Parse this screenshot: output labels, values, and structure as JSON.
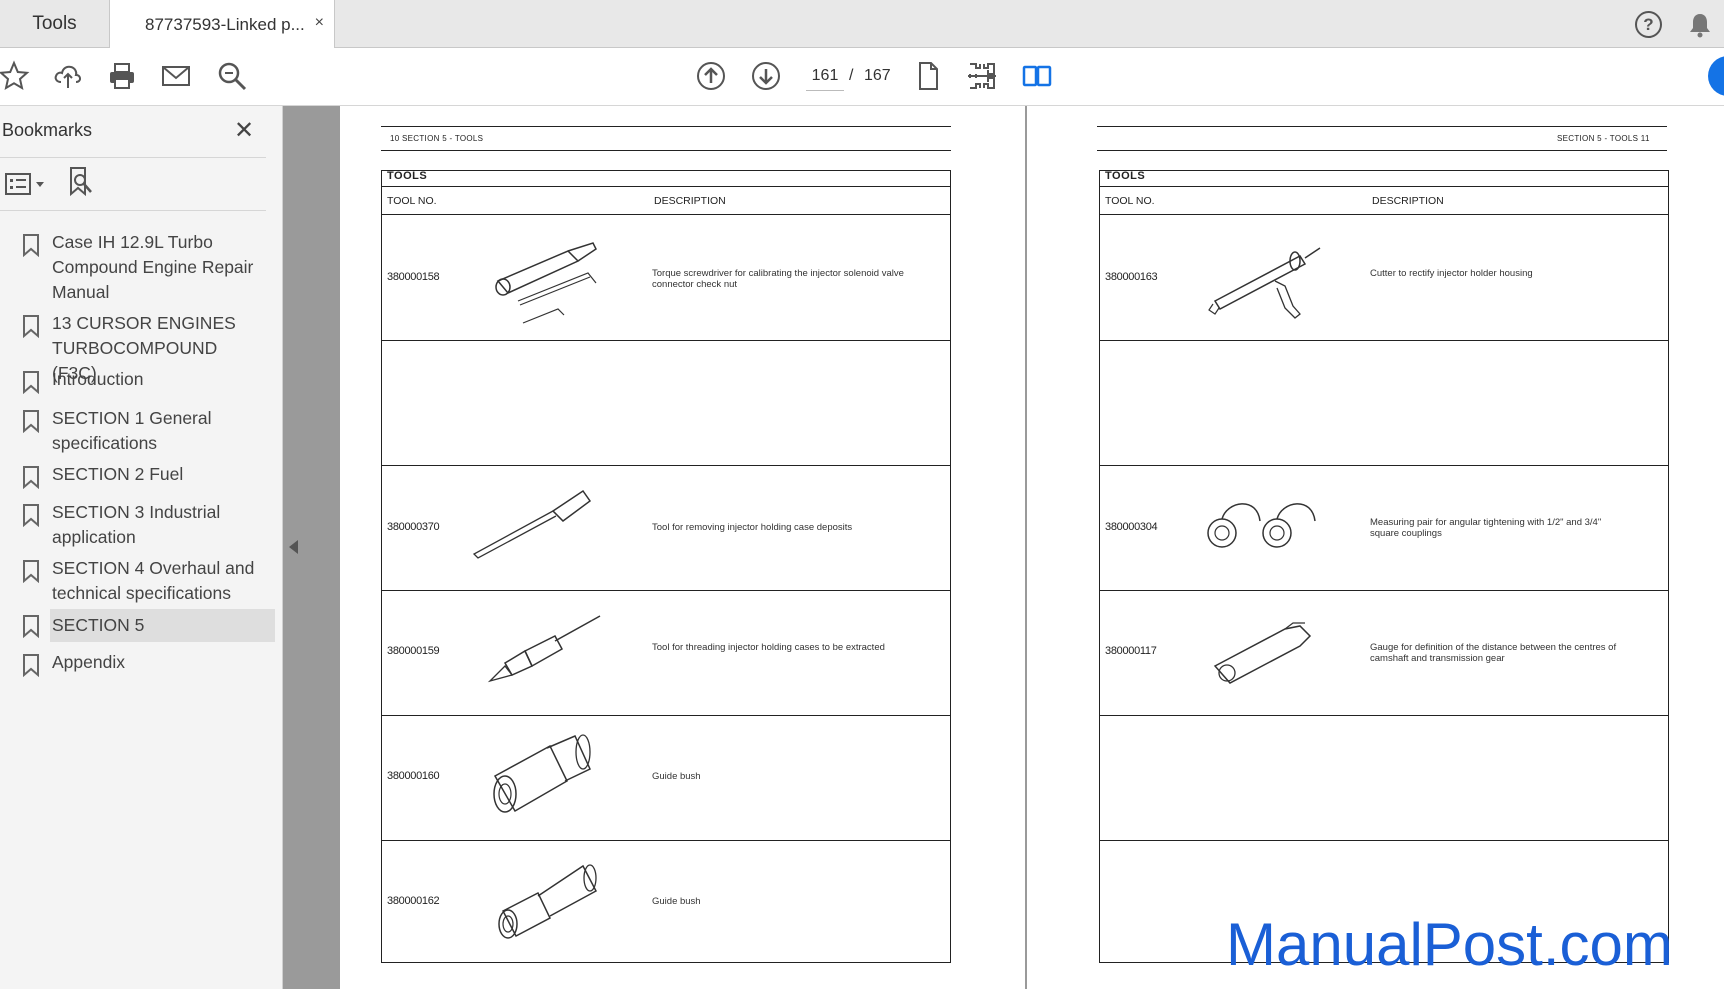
{
  "tabs": {
    "tools_label": "Tools",
    "doc_label": "87737593-Linked p...",
    "close_label": "×"
  },
  "toolbar": {
    "current_page": "161",
    "separator": "/",
    "total_pages": "167",
    "help_label": "?"
  },
  "sidebar": {
    "title": "Bookmarks",
    "close_label": "✕",
    "items": [
      {
        "label": "Case IH 12.9L Turbo Compound Engine Repair Manual"
      },
      {
        "label": "13 CURSOR ENGINES TURBOCOMPOUND (F3C)"
      },
      {
        "label": "Introduction"
      },
      {
        "label": "SECTION 1 General specifications"
      },
      {
        "label": "SECTION 2 Fuel"
      },
      {
        "label": "SECTION 3 Industrial application"
      },
      {
        "label": "SECTION 4 Overhaul and technical specifications"
      },
      {
        "label": "SECTION 5"
      },
      {
        "label": "Appendix"
      }
    ],
    "active_index": 7
  },
  "pages": {
    "left": {
      "header": "10   SECTION 5 - TOOLS",
      "title": "TOOLS",
      "col_tool_no": "TOOL NO.",
      "col_description": "DESCRIPTION",
      "rows": [
        {
          "tool_no": "380000158",
          "description": "Torque screwdriver for calibrating the injector solenoid valve connector check nut"
        },
        {
          "tool_no": "",
          "description": ""
        },
        {
          "tool_no": "380000370",
          "description": "Tool for removing injector holding case deposits"
        },
        {
          "tool_no": "380000159",
          "description": "Tool for threading injector holding cases to be extracted"
        },
        {
          "tool_no": "380000160",
          "description": "Guide bush"
        },
        {
          "tool_no": "380000162",
          "description": "Guide bush"
        }
      ]
    },
    "right": {
      "header": "SECTION 5 - TOOLS   11",
      "title": "TOOLS",
      "col_tool_no": "TOOL NO.",
      "col_description": "DESCRIPTION",
      "rows": [
        {
          "tool_no": "380000163",
          "description": "Cutter to rectify injector holder housing"
        },
        {
          "tool_no": "",
          "description": ""
        },
        {
          "tool_no": "380000304",
          "description": "Measuring pair for angular tightening with 1/2\" and 3/4\" square couplings"
        },
        {
          "tool_no": "380000117",
          "description": "Gauge for definition of the distance between the centres of camshaft and transmission gear"
        },
        {
          "tool_no": "",
          "description": ""
        },
        {
          "tool_no": "",
          "description": ""
        }
      ]
    }
  },
  "watermark": "ManualPost.com"
}
